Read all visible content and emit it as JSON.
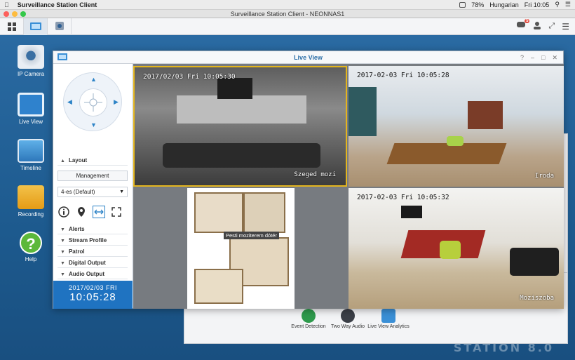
{
  "menubar": {
    "app_name": "Surveillance Station Client",
    "battery": "78%",
    "language": "Hungarian",
    "clock": "Fri 10:05"
  },
  "window": {
    "title": "Surveillance Station Client - NEONNAS1"
  },
  "toolbar": {
    "notification_count": "5"
  },
  "desktop_icons": [
    {
      "label": "IP Camera",
      "icon": "ip-camera-icon"
    },
    {
      "label": "Live View",
      "icon": "live-view-icon"
    },
    {
      "label": "Timeline",
      "icon": "timeline-icon"
    },
    {
      "label": "Recording",
      "icon": "recording-icon"
    },
    {
      "label": "Help",
      "icon": "help-icon"
    }
  ],
  "watermark": "STATION 8.0",
  "background_panel": {
    "features": [
      {
        "label": "Event Detection",
        "color": "#2e9a4c"
      },
      {
        "label": "Two Way Audio",
        "color": "#3b3f47"
      },
      {
        "label": "Live View Analytics",
        "color": "#3a8fd6"
      }
    ]
  },
  "liveview": {
    "title": "Live View",
    "controls": [
      "?",
      "–",
      "□",
      "✕"
    ],
    "sidebar": {
      "layout_header": "Layout",
      "management_button": "Management",
      "layout_select": "4-es (Default)",
      "sections": [
        "Alerts",
        "Stream Profile",
        "Patrol",
        "Digital Output",
        "Audio Output"
      ],
      "date": "2017/02/03 FRI",
      "time": "10:05:28"
    },
    "cameras": [
      {
        "timestamp": "2017/02/03 Fri 10:05:30",
        "name": "Szeged mozi"
      },
      {
        "timestamp": "2017-02-03 Fri 10:05:28",
        "name": "Iroda"
      },
      {
        "timestamp": "2017-02-03 Fri 10:05:32",
        "name": "Moziszoba"
      }
    ],
    "map_tooltip": "Pesti moziterem  dótér"
  },
  "colors": {
    "accent": "#1f73c1",
    "desktop": "#1f5f93",
    "selected_border": "#e3b51e"
  }
}
